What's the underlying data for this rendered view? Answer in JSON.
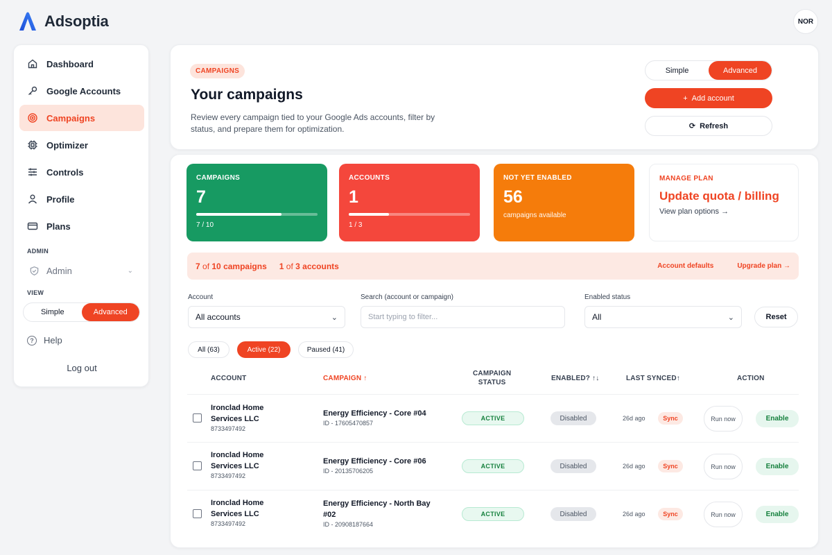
{
  "app": {
    "name": "Adsoptia",
    "user_initials": "NOR"
  },
  "sidebar": {
    "items": [
      {
        "label": "Dashboard",
        "icon": "home-icon"
      },
      {
        "label": "Google Accounts",
        "icon": "key-icon"
      },
      {
        "label": "Campaigns",
        "icon": "target-icon",
        "active": true
      },
      {
        "label": "Optimizer",
        "icon": "chip-icon"
      },
      {
        "label": "Controls",
        "icon": "sliders-icon"
      },
      {
        "label": "Profile",
        "icon": "user-icon"
      },
      {
        "label": "Plans",
        "icon": "card-icon"
      }
    ],
    "admin_section": "ADMIN",
    "admin_label": "Admin",
    "view_section": "VIEW",
    "view_simple": "Simple",
    "view_advanced": "Advanced",
    "help": "Help",
    "help_glyph": "?",
    "logout": "Log out"
  },
  "header": {
    "tag": "CAMPAIGNS",
    "title": "Your campaigns",
    "description": "Review every campaign tied to your Google Ads accounts, filter by status, and prepare them for optimization.",
    "mode_simple": "Simple",
    "mode_advanced": "Advanced",
    "add_account": "Add account",
    "add_glyph": "+",
    "refresh": "Refresh",
    "refresh_glyph": "⟳"
  },
  "stats": {
    "campaigns": {
      "label": "CAMPAIGNS",
      "value": "7",
      "sub": "7 / 10",
      "progress": 0.7,
      "color": "#179a62"
    },
    "accounts": {
      "label": "ACCOUNTS",
      "value": "1",
      "sub": "1 / 3",
      "progress": 0.333,
      "color": "#f4473c"
    },
    "not_enabled": {
      "label": "NOT YET ENABLED",
      "value": "56",
      "sub": "campaigns available",
      "color": "#f57c0b"
    },
    "plan": {
      "label": "MANAGE PLAN",
      "title": "Update quota / billing",
      "link": "View plan options →"
    }
  },
  "summary": {
    "camp_count": "7",
    "camp_of": " of ",
    "camp_total": "10",
    "camp_word": " campaigns",
    "acc_count": "1",
    "acc_of": " of ",
    "acc_total": "3",
    "acc_word": " accounts",
    "account_defaults": "Account defaults",
    "upgrade_plan": "Upgrade plan →"
  },
  "filters": {
    "account_label": "Account",
    "account_value": "All accounts",
    "search_label": "Search (account or campaign)",
    "search_placeholder": "Start typing to filter...",
    "status_label": "Enabled status",
    "status_value": "All",
    "reset": "Reset",
    "chevron": "⌄"
  },
  "chips": [
    {
      "label": "All (63)",
      "active": false
    },
    {
      "label": "Active (22)",
      "active": true
    },
    {
      "label": "Paused (41)",
      "active": false
    }
  ],
  "table": {
    "headers": {
      "account": "ACCOUNT",
      "campaign": "CAMPAIGN ↑",
      "status_l1": "CAMPAIGN",
      "status_l2": "STATUS",
      "enabled": "ENABLED? ↑↓",
      "synced": "LAST SYNCED↑",
      "action": "ACTION"
    },
    "rows": [
      {
        "account": "Ironclad Home Services LLC",
        "account_id": "8733497492",
        "campaign": "Energy Efficiency - Core #04",
        "campaign_id": "ID - 17605470857",
        "status": "ACTIVE",
        "enabled": "Disabled",
        "synced": "26d ago",
        "sync": "Sync",
        "run": "Run now",
        "action": "Enable"
      },
      {
        "account": "Ironclad Home Services LLC",
        "account_id": "8733497492",
        "campaign": "Energy Efficiency - Core #06",
        "campaign_id": "ID - 20135706205",
        "status": "ACTIVE",
        "enabled": "Disabled",
        "synced": "26d ago",
        "sync": "Sync",
        "run": "Run now",
        "action": "Enable"
      },
      {
        "account": "Ironclad Home Services LLC",
        "account_id": "8733497492",
        "campaign": "Energy Efficiency - North Bay #02",
        "campaign_id": "ID - 20908187664",
        "status": "ACTIVE",
        "enabled": "Disabled",
        "synced": "26d ago",
        "sync": "Sync",
        "run": "Run now",
        "action": "Enable"
      }
    ]
  },
  "colors": {
    "accent": "#ef4423",
    "green": "#179a62",
    "red": "#f4473c",
    "orange": "#f57c0b",
    "logo": "#2563eb"
  }
}
